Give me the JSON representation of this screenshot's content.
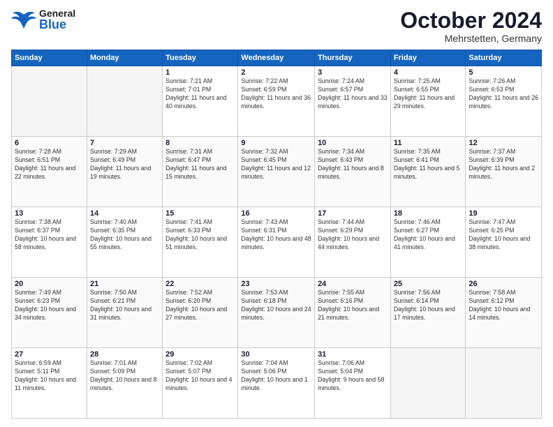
{
  "header": {
    "logo": {
      "general": "General",
      "blue": "Blue"
    },
    "title": "October 2024",
    "location": "Mehrstetten, Germany"
  },
  "weekdays": [
    "Sunday",
    "Monday",
    "Tuesday",
    "Wednesday",
    "Thursday",
    "Friday",
    "Saturday"
  ],
  "weeks": [
    [
      {
        "day": "",
        "info": ""
      },
      {
        "day": "",
        "info": ""
      },
      {
        "day": "1",
        "info": "Sunrise: 7:21 AM\nSunset: 7:01 PM\nDaylight: 11 hours and 40 minutes."
      },
      {
        "day": "2",
        "info": "Sunrise: 7:22 AM\nSunset: 6:59 PM\nDaylight: 11 hours and 36 minutes."
      },
      {
        "day": "3",
        "info": "Sunrise: 7:24 AM\nSunset: 6:57 PM\nDaylight: 11 hours and 33 minutes."
      },
      {
        "day": "4",
        "info": "Sunrise: 7:25 AM\nSunset: 6:55 PM\nDaylight: 11 hours and 29 minutes."
      },
      {
        "day": "5",
        "info": "Sunrise: 7:26 AM\nSunset: 6:53 PM\nDaylight: 11 hours and 26 minutes."
      }
    ],
    [
      {
        "day": "6",
        "info": "Sunrise: 7:28 AM\nSunset: 6:51 PM\nDaylight: 11 hours and 22 minutes."
      },
      {
        "day": "7",
        "info": "Sunrise: 7:29 AM\nSunset: 6:49 PM\nDaylight: 11 hours and 19 minutes."
      },
      {
        "day": "8",
        "info": "Sunrise: 7:31 AM\nSunset: 6:47 PM\nDaylight: 11 hours and 15 minutes."
      },
      {
        "day": "9",
        "info": "Sunrise: 7:32 AM\nSunset: 6:45 PM\nDaylight: 11 hours and 12 minutes."
      },
      {
        "day": "10",
        "info": "Sunrise: 7:34 AM\nSunset: 6:43 PM\nDaylight: 11 hours and 8 minutes."
      },
      {
        "day": "11",
        "info": "Sunrise: 7:35 AM\nSunset: 6:41 PM\nDaylight: 11 hours and 5 minutes."
      },
      {
        "day": "12",
        "info": "Sunrise: 7:37 AM\nSunset: 6:39 PM\nDaylight: 11 hours and 2 minutes."
      }
    ],
    [
      {
        "day": "13",
        "info": "Sunrise: 7:38 AM\nSunset: 6:37 PM\nDaylight: 10 hours and 58 minutes."
      },
      {
        "day": "14",
        "info": "Sunrise: 7:40 AM\nSunset: 6:35 PM\nDaylight: 10 hours and 55 minutes."
      },
      {
        "day": "15",
        "info": "Sunrise: 7:41 AM\nSunset: 6:33 PM\nDaylight: 10 hours and 51 minutes."
      },
      {
        "day": "16",
        "info": "Sunrise: 7:43 AM\nSunset: 6:31 PM\nDaylight: 10 hours and 48 minutes."
      },
      {
        "day": "17",
        "info": "Sunrise: 7:44 AM\nSunset: 6:29 PM\nDaylight: 10 hours and 44 minutes."
      },
      {
        "day": "18",
        "info": "Sunrise: 7:46 AM\nSunset: 6:27 PM\nDaylight: 10 hours and 41 minutes."
      },
      {
        "day": "19",
        "info": "Sunrise: 7:47 AM\nSunset: 6:25 PM\nDaylight: 10 hours and 38 minutes."
      }
    ],
    [
      {
        "day": "20",
        "info": "Sunrise: 7:49 AM\nSunset: 6:23 PM\nDaylight: 10 hours and 34 minutes."
      },
      {
        "day": "21",
        "info": "Sunrise: 7:50 AM\nSunset: 6:21 PM\nDaylight: 10 hours and 31 minutes."
      },
      {
        "day": "22",
        "info": "Sunrise: 7:52 AM\nSunset: 6:20 PM\nDaylight: 10 hours and 27 minutes."
      },
      {
        "day": "23",
        "info": "Sunrise: 7:53 AM\nSunset: 6:18 PM\nDaylight: 10 hours and 24 minutes."
      },
      {
        "day": "24",
        "info": "Sunrise: 7:55 AM\nSunset: 6:16 PM\nDaylight: 10 hours and 21 minutes."
      },
      {
        "day": "25",
        "info": "Sunrise: 7:56 AM\nSunset: 6:14 PM\nDaylight: 10 hours and 17 minutes."
      },
      {
        "day": "26",
        "info": "Sunrise: 7:58 AM\nSunset: 6:12 PM\nDaylight: 10 hours and 14 minutes."
      }
    ],
    [
      {
        "day": "27",
        "info": "Sunrise: 6:59 AM\nSunset: 5:11 PM\nDaylight: 10 hours and 11 minutes."
      },
      {
        "day": "28",
        "info": "Sunrise: 7:01 AM\nSunset: 5:09 PM\nDaylight: 10 hours and 8 minutes."
      },
      {
        "day": "29",
        "info": "Sunrise: 7:02 AM\nSunset: 5:07 PM\nDaylight: 10 hours and 4 minutes."
      },
      {
        "day": "30",
        "info": "Sunrise: 7:04 AM\nSunset: 5:06 PM\nDaylight: 10 hours and 1 minute."
      },
      {
        "day": "31",
        "info": "Sunrise: 7:06 AM\nSunset: 5:04 PM\nDaylight: 9 hours and 58 minutes."
      },
      {
        "day": "",
        "info": ""
      },
      {
        "day": "",
        "info": ""
      }
    ]
  ]
}
